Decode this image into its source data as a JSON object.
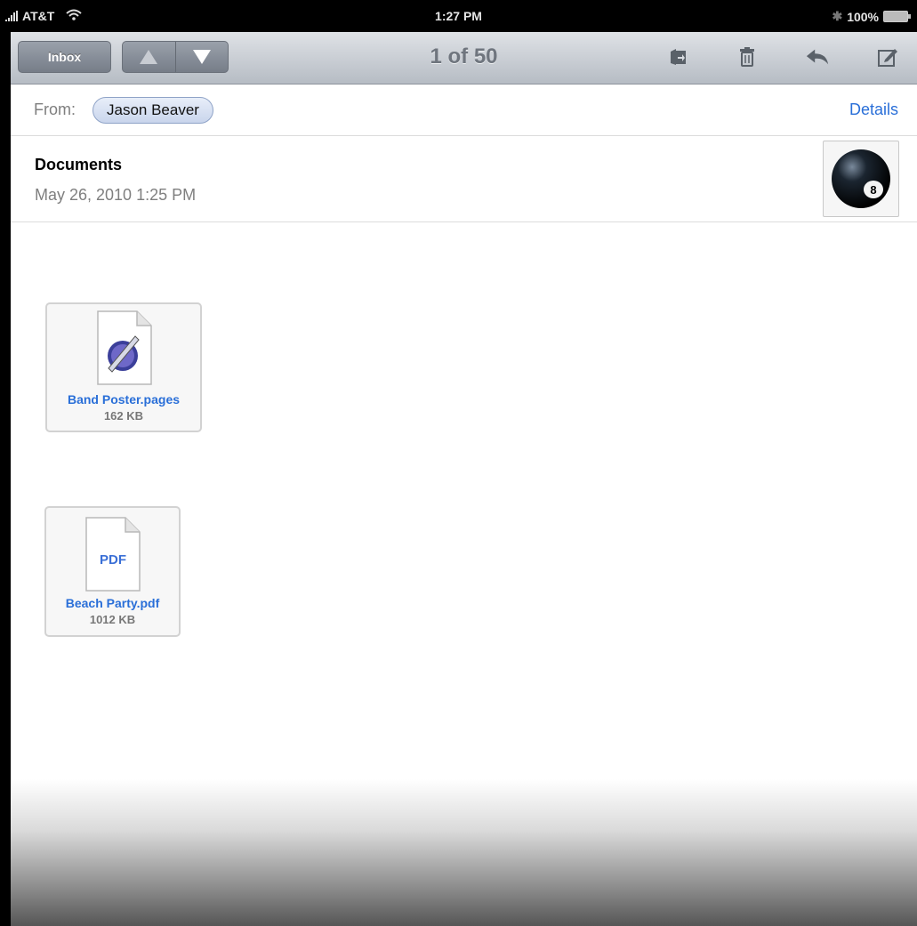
{
  "status_bar": {
    "carrier": "AT&T",
    "time": "1:27 PM",
    "battery": "100%"
  },
  "toolbar": {
    "inbox_label": "Inbox",
    "counter": "1 of 50"
  },
  "message": {
    "from_label": "From:",
    "from_name": "Jason Beaver",
    "details_label": "Details",
    "subject": "Documents",
    "date": "May 26, 2010 1:25 PM"
  },
  "attachments": [
    {
      "name": "Band Poster.pages",
      "size": "162 KB",
      "icon": "pages-document-icon"
    },
    {
      "name": "Beach Party.pdf",
      "size": "1012 KB",
      "icon": "pdf-document-icon",
      "icon_text": "PDF"
    }
  ],
  "colors": {
    "link": "#2a6fd8",
    "toolbar_top": "#dfe2e6",
    "toolbar_bottom": "#b6bcc4"
  }
}
